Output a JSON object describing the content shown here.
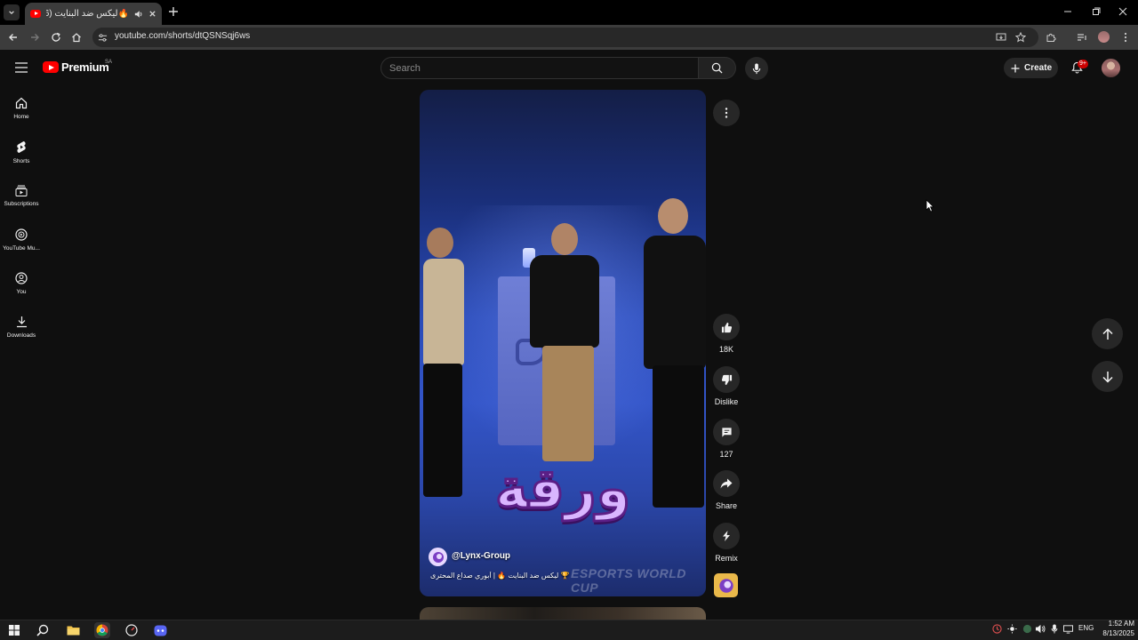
{
  "browser": {
    "tab_title": "🔥ليكس ضد البنايت (4546)",
    "url": "youtube.com/shorts/dtQSNSqj6ws"
  },
  "masthead": {
    "logo_text": "Premium",
    "country_code": "SA",
    "search_placeholder": "Search",
    "create_label": "Create",
    "notification_badge": "9+"
  },
  "sidebar": {
    "items": [
      {
        "label": "Home",
        "icon": "home-icon"
      },
      {
        "label": "Shorts",
        "icon": "shorts-icon"
      },
      {
        "label": "Subscriptions",
        "icon": "subscriptions-icon"
      },
      {
        "label": "YouTube Mu...",
        "icon": "youtube-music-icon"
      },
      {
        "label": "You",
        "icon": "you-icon"
      },
      {
        "label": "Downloads",
        "icon": "download-icon"
      }
    ]
  },
  "short": {
    "overlay_word": "ورقة",
    "channel_handle": "@Lynx-Group",
    "caption": "🏆 ليكس ضد البنايت 🔥 | أبوري صداع المحترى",
    "watermark": "ESPORTS WORLD CUP"
  },
  "actions": {
    "likes": "18K",
    "dislike_label": "Dislike",
    "comments": "127",
    "share_label": "Share",
    "remix_label": "Remix"
  },
  "taskbar": {
    "language": "ENG",
    "time": "1:52 AM",
    "date": "8/13/2025"
  },
  "colors": {
    "background": "#0f0f0f",
    "brand_red": "#ff0000",
    "chip": "#272727",
    "overlay_text": "#d9b6ff"
  }
}
